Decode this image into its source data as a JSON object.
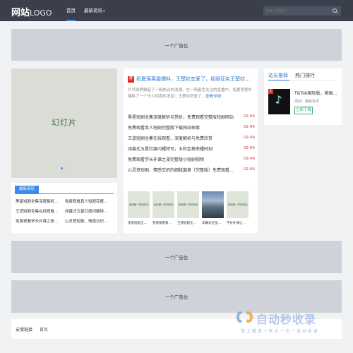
{
  "header": {
    "logo_cn": "网站",
    "logo_en": "LOGO",
    "nav": [
      {
        "label": "首页"
      },
      {
        "label": "最新资讯"
      }
    ],
    "search_placeholder": "请输入关键词"
  },
  "ads": {
    "top": "一个广告位",
    "mid1": "一个广告位",
    "mid2": "一个广告位"
  },
  "slider": {
    "label": "幻灯片"
  },
  "latest": {
    "tab": "最新资讯",
    "items": [
      "黑星短剧全集深度解析…",
      "免费观看真人短剧完整…",
      "王道短剧全集在线观看…",
      "闭幕式五星红旗闪耀特…",
      "免费观看学长补课之旅…",
      "心灵意短剧，情感交织…"
    ]
  },
  "headline": {
    "badge": "荐",
    "title": "祝夏莲离婚爆料，王楚钦恋爱了，视频证实王楚钦…",
    "desc": "乒乓球界掀起了一股热议的浪潮，在一场备受关注的直播中，祝夏莲意外爆料了一个令人惊喜的消息：王楚钦恋爱了…",
    "more": "查看详细"
  },
  "news": [
    {
      "title": "黑星短剧全集深度解析与赏析，免费观看完整版短剧网站",
      "date": "02-04"
    },
    {
      "title": "免费观看真人短剧完整版下载网站探索",
      "date": "02-04"
    },
    {
      "title": "王道短剧全集在线观看，深度解析与免费欣赏",
      "date": "02-04"
    },
    {
      "title": "闭幕式五星红旗闪耀特写，五秒定格荣耀时刻",
      "date": "02-04"
    },
    {
      "title": "免费观看学长补课之旅完整版小短剧视频",
      "date": "02-04"
    },
    {
      "title": "心灵意短剧，情感交织的细腻篇章（完整版）免费观看…",
      "date": "02-04"
    }
  ],
  "thumbs": [
    {
      "img_text": "宝库器一样的网站",
      "caption": "黑星短剧全…",
      "photo": false
    },
    {
      "img_text": "宝库器一样的网站",
      "caption": "免费观看真…",
      "photo": false
    },
    {
      "img_text": "宝库器一样的网站",
      "caption": "王道短剧全…",
      "photo": false
    },
    {
      "img_text": "",
      "caption": "闭幕式五星…",
      "photo": true
    },
    {
      "img_text": "宝库器一样的网站",
      "caption": "学长补课之…",
      "photo": false
    }
  ],
  "right": {
    "tabs": [
      "站长推荐",
      "热门排行"
    ],
    "app": {
      "rank": "1",
      "name": "TikTok国际版，美国网友…",
      "category": "类别：最新资讯",
      "download": "立即下载"
    }
  },
  "friends": {
    "label": "友情链接",
    "links": [
      "首页"
    ]
  },
  "watermark": {
    "text": "自动秒收录",
    "sub": "做 上 精 选 一 来 访 一 次 一 自 动 收 录"
  },
  "colors": {
    "header_bg": "#3a3f4b",
    "accent": "#3b8ee8",
    "date_red": "#d7312b",
    "download_green": "#3bb273"
  }
}
